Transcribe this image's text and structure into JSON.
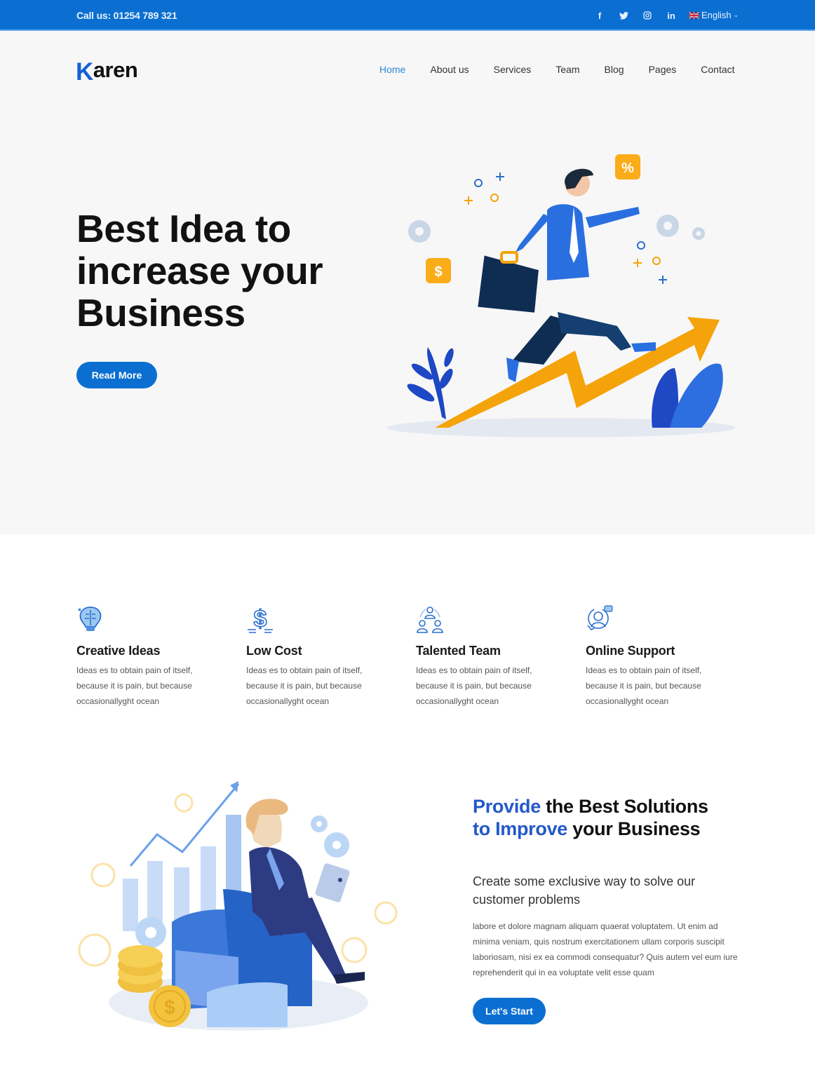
{
  "topbar": {
    "call_text": "Call us: 01254 789 321",
    "social": [
      {
        "icon": "facebook-icon",
        "glyph": "f"
      },
      {
        "icon": "twitter-icon",
        "glyph": "🐦"
      },
      {
        "icon": "instagram-icon",
        "glyph": "◎"
      },
      {
        "icon": "linkedin-icon",
        "glyph": "in"
      }
    ],
    "language": "English",
    "language_flag": "uk-flag-icon"
  },
  "header": {
    "logo_first": "K",
    "logo_rest": "aren",
    "nav": [
      {
        "label": "Home",
        "active": true
      },
      {
        "label": "About us",
        "active": false
      },
      {
        "label": "Services",
        "active": false
      },
      {
        "label": "Team",
        "active": false
      },
      {
        "label": "Blog",
        "active": false
      },
      {
        "label": "Pages",
        "active": false
      },
      {
        "label": "Contact",
        "active": false
      }
    ]
  },
  "hero": {
    "title": "Best Idea to increase your Business",
    "button_label": "Read More",
    "illustration": "businessman-running-up-arrow-illustration"
  },
  "features": [
    {
      "icon": "lightbulb-brain-icon",
      "title": "Creative Ideas",
      "text": "Ideas es to obtain pain of itself, because it is pain, but because occasionallyght ocean"
    },
    {
      "icon": "dollar-icon",
      "title": "Low Cost",
      "text": "Ideas es to obtain pain of itself, because it is pain, but because occasionallyght ocean"
    },
    {
      "icon": "team-icon",
      "title": "Talented Team",
      "text": "Ideas es to obtain pain of itself, because it is pain, but because occasionallyght ocean"
    },
    {
      "icon": "support-agent-icon",
      "title": "Online Support",
      "text": "Ideas es to obtain pain of itself, because it is pain, but because occasionallyght ocean"
    }
  ],
  "solutions": {
    "title_parts": [
      {
        "text": "Provide",
        "highlight": true
      },
      {
        "text": " the Best Solutions ",
        "highlight": false
      },
      {
        "text": "to Improve",
        "highlight": true
      },
      {
        "text": " your Business",
        "highlight": false
      }
    ],
    "subtitle": "Create some exclusive way to solve our customer problems",
    "body": "labore et dolore magnam aliquam quaerat voluptatem. Ut enim ad minima veniam, quis nostrum exercitationem ullam corporis suscipit laboriosam, nisi ex ea commodi consequatur? Quis autem vel eum iure reprehenderit qui in ea voluptate velit esse quam",
    "button_label": "Let's Start",
    "illustration": "businessman-sitting-on-chart-illustration"
  },
  "colors": {
    "primary": "#0a6fd1",
    "highlight": "#2458c8",
    "accent_orange": "#f5a30a",
    "hero_bg": "#f7f7f7"
  }
}
